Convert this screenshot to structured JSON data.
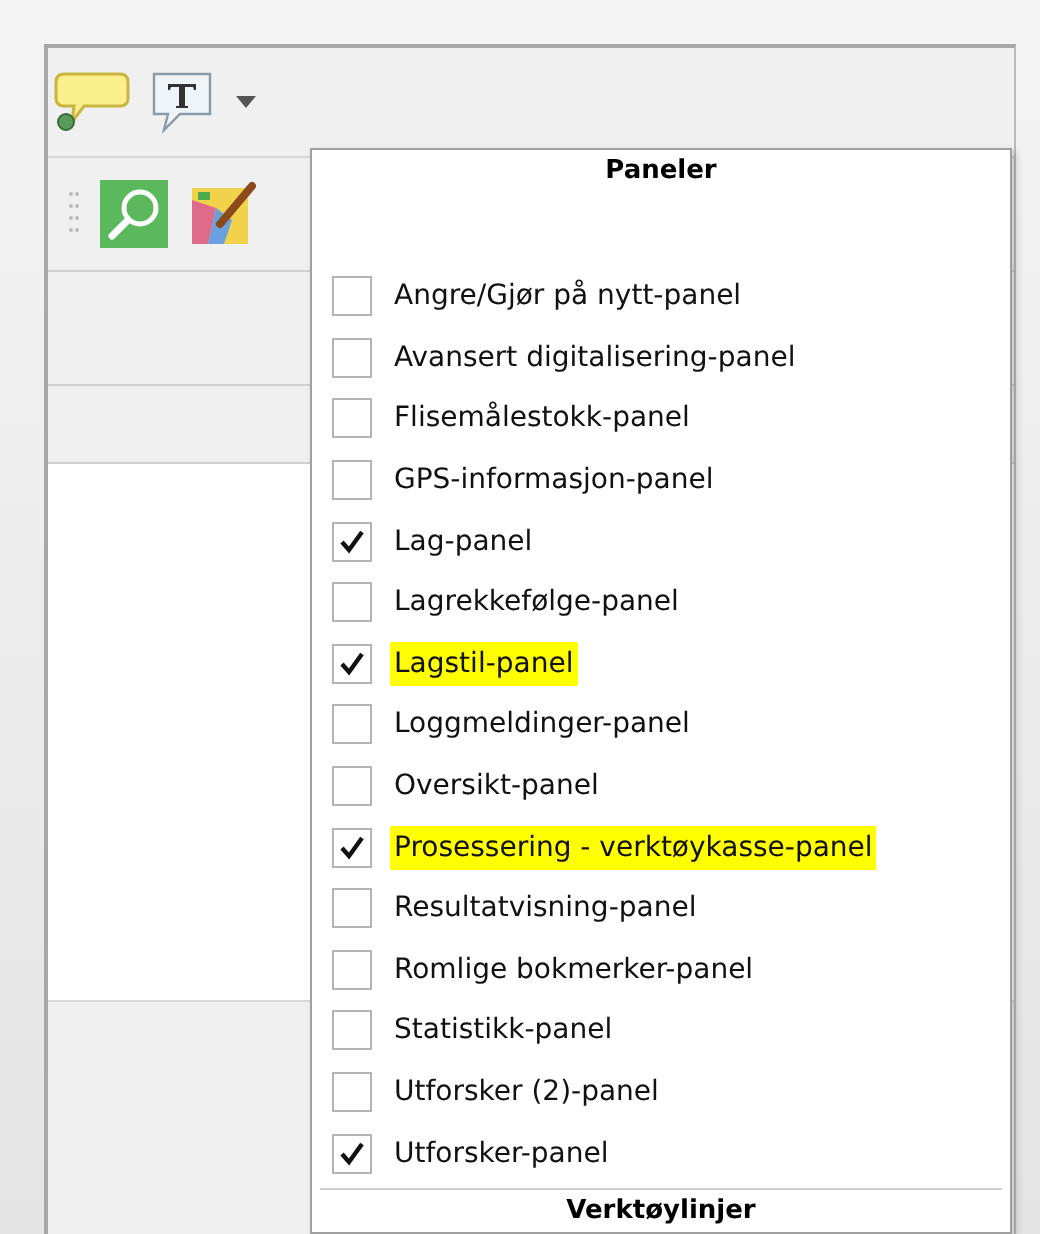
{
  "menu": {
    "sections": [
      {
        "title": "Paneler",
        "items": [
          {
            "label": "Angre/Gjør på nytt-panel",
            "checked": false,
            "highlighted": false
          },
          {
            "label": "Avansert digitalisering-panel",
            "checked": false,
            "highlighted": false
          },
          {
            "label": "Flisemålestokk-panel",
            "checked": false,
            "highlighted": false
          },
          {
            "label": "GPS-informasjon-panel",
            "checked": false,
            "highlighted": false
          },
          {
            "label": "Lag-panel",
            "checked": true,
            "highlighted": false
          },
          {
            "label": "Lagrekkefølge-panel",
            "checked": false,
            "highlighted": false
          },
          {
            "label": "Lagstil-panel",
            "checked": true,
            "highlighted": true
          },
          {
            "label": "Loggmeldinger-panel",
            "checked": false,
            "highlighted": false
          },
          {
            "label": "Oversikt-panel",
            "checked": false,
            "highlighted": false
          },
          {
            "label": "Prosessering - verktøykasse-panel",
            "checked": true,
            "highlighted": true
          },
          {
            "label": "Resultatvisning-panel",
            "checked": false,
            "highlighted": false
          },
          {
            "label": "Romlige bokmerker-panel",
            "checked": false,
            "highlighted": false
          },
          {
            "label": "Statistikk-panel",
            "checked": false,
            "highlighted": false
          },
          {
            "label": "Utforsker (2)-panel",
            "checked": false,
            "highlighted": false
          },
          {
            "label": "Utforsker-panel",
            "checked": true,
            "highlighted": false
          }
        ]
      },
      {
        "title": "Verktøylinjer"
      }
    ]
  }
}
